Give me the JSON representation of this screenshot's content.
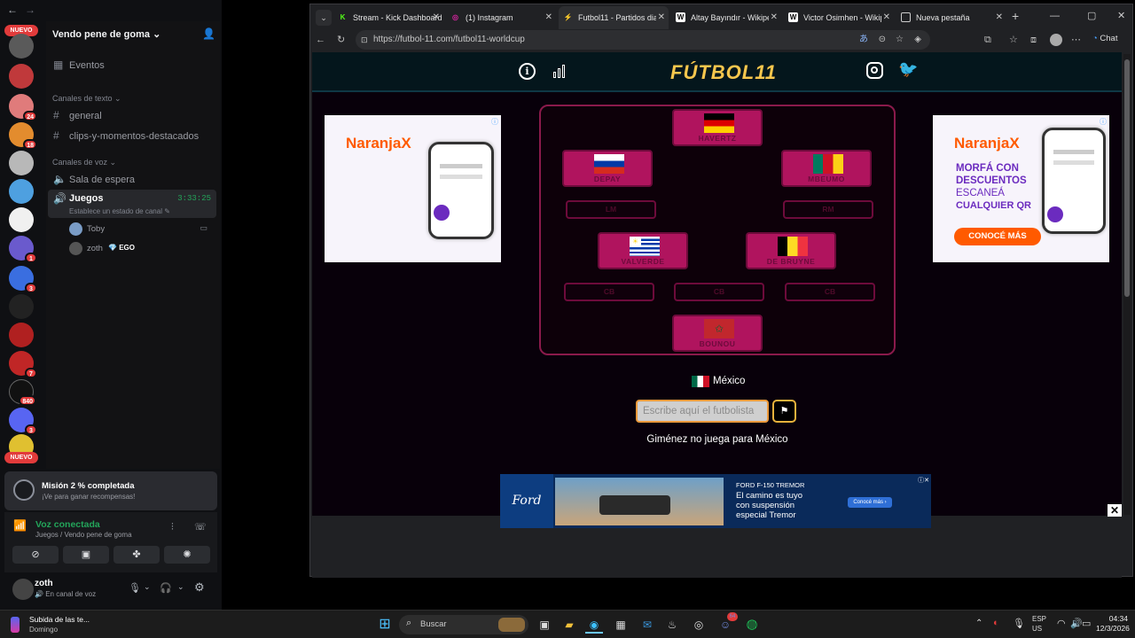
{
  "window_controls": {
    "back": "←",
    "forward": "→"
  },
  "discord": {
    "server_name": "Vendo pene de goma",
    "server_badges": [
      "NUEVO",
      "24",
      "18",
      "1",
      "3",
      "7",
      "840",
      "3",
      "NUEVO"
    ],
    "events": "Eventos",
    "text_category": "Canales de texto",
    "text_channels": [
      "general",
      "clips-y-momentos-destacados"
    ],
    "voice_category": "Canales de voz",
    "voice_channels": [
      "Sala de espera",
      "Juegos"
    ],
    "voice_timer": "3:33:25",
    "voice_status": "Establece un estado de canal",
    "voice_members": [
      "Toby",
      "zoth"
    ],
    "member_tag": "EGO",
    "mission_title": "Misión 2 % completada",
    "mission_sub": "¡Ve para ganar recompensas!",
    "voice_connected": "Voz conectada",
    "voice_location": "Juegos / Vendo pene de goma",
    "user_name": "zoth",
    "user_status": "En canal de voz"
  },
  "browser": {
    "tabs": [
      {
        "label": "Stream - Kick Dashboard",
        "fav": "K",
        "color": "#53fc18"
      },
      {
        "label": "(1) Instagram",
        "fav": "◎",
        "color": "#d6249f"
      },
      {
        "label": "Futbol11 - Partidos diari",
        "fav": "⚡",
        "color": "#3b5bdb"
      },
      {
        "label": "Altay Bayındır - Wikipedi",
        "fav": "W",
        "color": "#ffffff"
      },
      {
        "label": "Victor Osimhen - Wikipe",
        "fav": "W",
        "color": "#ffffff"
      },
      {
        "label": "Nueva pestaña",
        "fav": "▢",
        "color": "#cccccc"
      }
    ],
    "url": "https://futbol-11.com/futbol11-worldcup",
    "chat_label": "Chat"
  },
  "futbol": {
    "logo": "FÚTBOL11",
    "players": {
      "gk": "HAVERTZ",
      "lw": "DEPAY",
      "rw": "MBEUMO",
      "lcm": "VALVERDE",
      "rcm": "DE BRUYNE",
      "st": "BOUNOU"
    },
    "slots": {
      "lm": "LM",
      "rm": "RM",
      "cb1": "CB",
      "cb2": "CB",
      "cb3": "CB"
    },
    "country": "México",
    "guess_placeholder": "Escribe aquí el futbolista",
    "feedback": "Giménez no juega para México"
  },
  "ads": {
    "brand": "NaranjaX",
    "right_line1": "MORFÁ CON",
    "right_line2": "DESCUENTOS",
    "right_line3": "ESCANEÁ",
    "right_line4": "CUALQUIER QR",
    "right_cta": "CONOCÉ MÁS",
    "banner_brand": "Ford",
    "banner_model": "FORD F-150 TREMOR",
    "banner_line1": "El camino es tuyo",
    "banner_line2": "con suspensión",
    "banner_line3": "especial Tremor",
    "banner_cta": "Conocé más ›"
  },
  "taskbar": {
    "media_title": "Subida de las te...",
    "media_sub": "Domingo",
    "search": "Buscar",
    "lang": "ESP",
    "region": "US",
    "time": "04:34",
    "date": "12/3/2026",
    "badge": "64"
  }
}
